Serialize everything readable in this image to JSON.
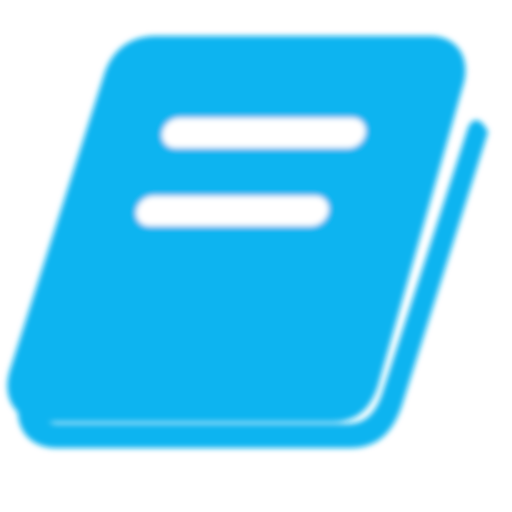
{
  "icon": {
    "name": "book-icon",
    "color": "#10b4f0",
    "background": "#ffffff"
  }
}
